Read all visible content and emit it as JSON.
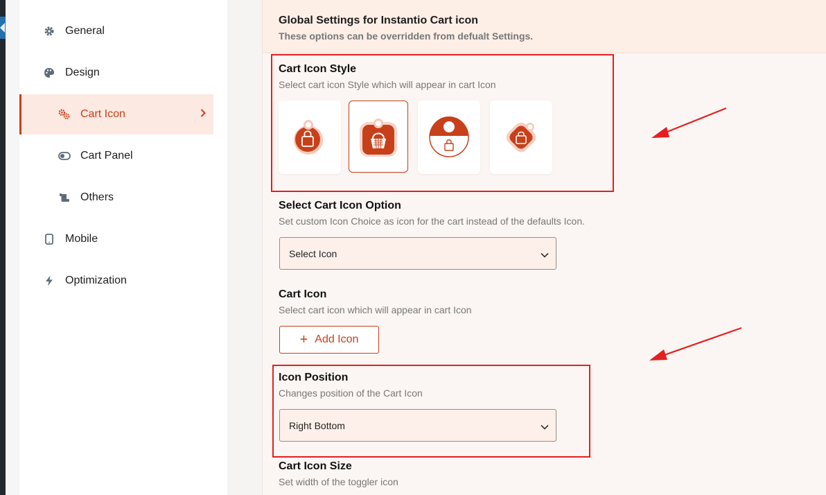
{
  "sidebar": {
    "items": [
      {
        "label": "General",
        "icon": "gear-icon"
      },
      {
        "label": "Design",
        "icon": "palette-icon"
      },
      {
        "label": "Cart Icon",
        "icon": "gears-icon",
        "active": true
      },
      {
        "label": "Cart Panel",
        "icon": "toggle-icon"
      },
      {
        "label": "Others",
        "icon": "scroll-icon"
      },
      {
        "label": "Mobile",
        "icon": "mobile-icon"
      },
      {
        "label": "Optimization",
        "icon": "bolt-icon"
      }
    ]
  },
  "header": {
    "title": "Global Settings for Instantio Cart icon",
    "subtitle": "These options can be overridden from defualt Settings."
  },
  "cart_icon_style": {
    "title": "Cart Icon Style",
    "description": "Select cart icon Style which will appear in cart Icon",
    "selected_index": 1
  },
  "cart_icon_option": {
    "title": "Select Cart Icon Option",
    "description": "Set custom Icon Choice as icon for the cart instead of the defaults Icon.",
    "value": "Select Icon"
  },
  "cart_icon": {
    "title": "Cart Icon",
    "description": "Select cart icon which will appear in cart Icon",
    "button_label": "Add Icon"
  },
  "icon_position": {
    "title": "Icon Position",
    "description": "Changes position of the Cart Icon",
    "value": "Right Bottom"
  },
  "cart_icon_size": {
    "title": "Cart Icon Size",
    "description": "Set width of the toggler icon"
  },
  "colors": {
    "accent": "#c8401a",
    "highlight": "#e41f1f"
  }
}
